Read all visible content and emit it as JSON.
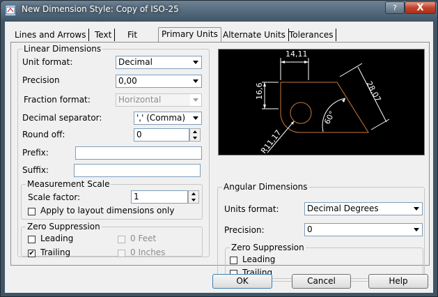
{
  "window": {
    "title": "New Dimension Style: Copy of ISO-25",
    "help_btn": "?",
    "close_btn": "X"
  },
  "tabs": [
    "Lines and Arrows",
    "Text",
    "Fit",
    "Primary Units",
    "Alternate Units",
    "Tolerances"
  ],
  "linear": {
    "legend": "Linear Dimensions",
    "unit_format_label": "Unit format:",
    "unit_format_value": "Decimal",
    "precision_label": "Precision",
    "precision_value": "0,00",
    "fraction_label": "Fraction format:",
    "fraction_value": "Horizontal",
    "decimal_sep_label": "Decimal separator:",
    "decimal_sep_value": "',' (Comma)",
    "round_off_label": "Round off:",
    "round_off_value": "0",
    "prefix_label": "Prefix:",
    "prefix_value": "",
    "suffix_label": "Suffix:",
    "suffix_value": ""
  },
  "measurement": {
    "legend": "Measurement Scale",
    "scale_label": "Scale factor:",
    "scale_value": "1",
    "apply_layout_label": "Apply to layout dimensions only",
    "apply_layout_checked": false
  },
  "zero_linear": {
    "legend": "Zero Suppression",
    "leading_label": "Leading",
    "leading_checked": false,
    "trailing_label": "Trailing",
    "trailing_checked": true,
    "feet_label": "0 Feet",
    "inches_label": "0 Inches"
  },
  "preview": {
    "dim_top": "14,11",
    "dim_left": "16,6",
    "dim_right": "28,07",
    "dim_angle": "60°",
    "dim_radius": "R11,17",
    "colors": {
      "background": "#000000",
      "dimension": "#ffffff",
      "geometry": "#c87a3c"
    }
  },
  "angular": {
    "legend": "Angular Dimensions",
    "units_format_label": "Units format:",
    "units_format_value": "Decimal Degrees",
    "precision_label": "Precision:",
    "precision_value": "0"
  },
  "zero_angular": {
    "legend": "Zero Suppression",
    "leading_label": "Leading",
    "leading_checked": false,
    "trailing_label": "Trailing",
    "trailing_checked": false
  },
  "buttons": {
    "ok": "OK",
    "cancel": "Cancel",
    "help": "Help"
  }
}
